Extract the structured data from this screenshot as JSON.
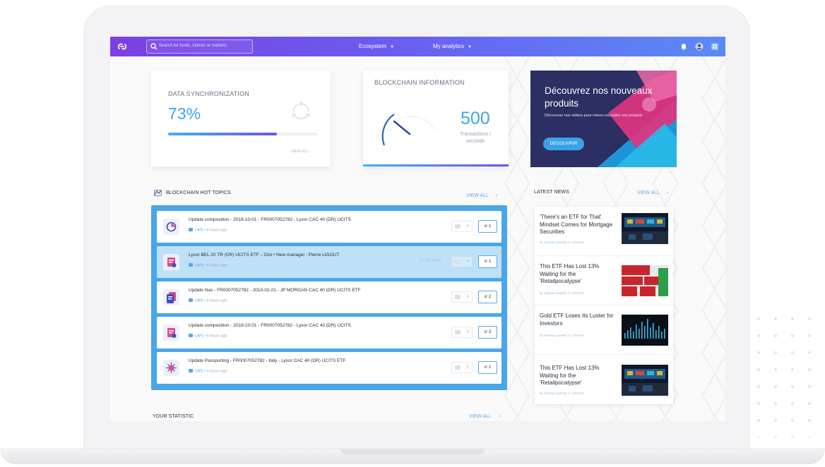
{
  "topbar": {
    "logo_glyph": "ℊ",
    "search_placeholder": "Search for funds, indices or markets",
    "nav": [
      {
        "label": "Ecosystem",
        "caret": "▼"
      },
      {
        "label": "My analytics",
        "caret": "▼"
      }
    ],
    "icons": [
      "bell-icon",
      "user-avatar-icon",
      "apps-icon"
    ]
  },
  "sync_card": {
    "title": "DATA SYNCHRONIZATION",
    "percent_text": "73%",
    "progress": 0.73,
    "view_all": "VIEW ALL  ›"
  },
  "blockchain_card": {
    "title": "BLOCKCHAIN INFORMATION",
    "value": "500",
    "unit_line1": "Transactions /",
    "unit_line2": "seconde"
  },
  "promo": {
    "title": "Découvrez nos nouveaux produits",
    "subtitle": "Découvrez nos vidéos pour mieux connaître nos produits",
    "button": "DECOUVRIR"
  },
  "hot_topics": {
    "title": "BLOCKCHAIN HOT TOPICS",
    "view_all": "VIEW ALL",
    "chevron": "›",
    "items": [
      {
        "title": "Update composition - 2018-10-01 - FR0007052782 - Lyxor CAC 40 (DR) UCITS",
        "source": "LWS",
        "time": "• 4 hours ago",
        "comments": "6",
        "votes": "1",
        "icon": "pie-chart-icon",
        "active": false
      },
      {
        "title": "Lyxor BEL 20 TR (DR) UCITS ETF – Dist • New manager : Pierre LIGOUT",
        "source": "LWS",
        "time": "• 4 hours ago",
        "comments": "6",
        "votes": "1",
        "icon": "document-chart-icon",
        "active": true,
        "ghost": "GO DETAILS"
      },
      {
        "title": "Update Nav - FR0007052782 - 2010-02-01 - JP MORGAN CAC 40 (DR) UCITS ETF",
        "source": "LWS",
        "time": "• 4 hours ago",
        "comments": "6",
        "votes": "2",
        "icon": "documents-icon",
        "active": false
      },
      {
        "title": "Update composition - 2018-10-01 - FR0007052782 - Lyxor CAC 40 (DR) UCITS",
        "source": "LWS",
        "time": "• 4 hours ago",
        "comments": "6",
        "votes": "3",
        "icon": "document-chart-icon",
        "active": false
      },
      {
        "title": "Update Passporting - FR0007052782 - Italy - Lyxor CAC 40 (DR) UCITS ETF",
        "source": "LWS",
        "time": "• 4 hours ago",
        "comments": "6",
        "votes": "1",
        "icon": "virus-icon",
        "active": false
      }
    ]
  },
  "latest_news": {
    "title": "LATEST NEWS",
    "view_all": "VIEW ALL",
    "chevron": "›",
    "items": [
      {
        "title": "'There's an ETF for That' Mindset Comes for Mortgage Securities",
        "author": "by Andrew Laurens",
        "date": "12/09/18",
        "thumb": "trading-floor"
      },
      {
        "title": "This ETF Has Lost 13% Waiting for the 'Retailpocalypse'",
        "author": "by Andrew Laurens",
        "date": "12/09/18",
        "thumb": "sale-signs"
      },
      {
        "title": "Gold ETF Loses Its Luster for Investors",
        "author": "by Andrew Laurens",
        "date": "12/09/18",
        "thumb": "bar-chart"
      },
      {
        "title": "This ETF Has Lost 13% Waiting for the 'Retailpocalypse'",
        "author": "by Andrew Laurens",
        "date": "12/09/18",
        "thumb": "trading-floor"
      }
    ]
  },
  "statistic": {
    "title": "YOUR STATISTIC",
    "view_all": "VIEW ALL",
    "chevron": "›"
  },
  "colors": {
    "accent": "#3fa3ea",
    "topbar_start": "#7b3fe4",
    "topbar_end": "#5a8bf7",
    "topics_bg": "#4aa6ea"
  }
}
